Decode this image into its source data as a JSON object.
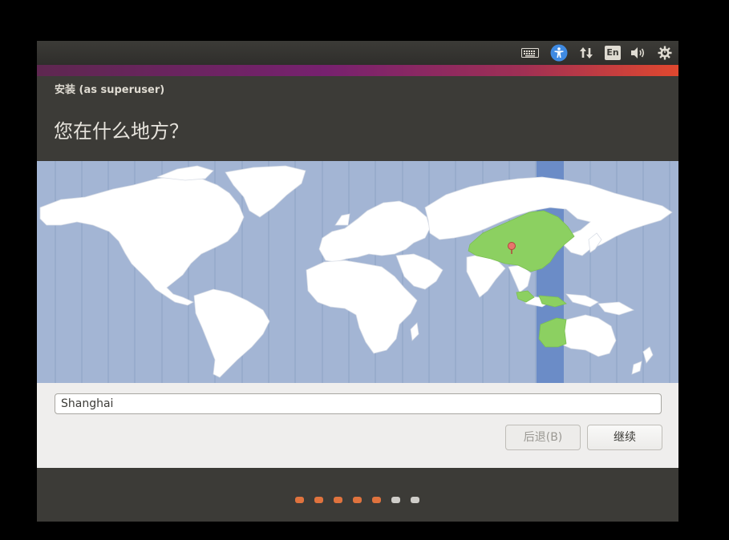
{
  "panel": {
    "indicators": [
      {
        "icon": "keyboard-icon"
      },
      {
        "icon": "accessibility-icon",
        "color": "#3f8ae2"
      },
      {
        "icon": "network-icon"
      },
      {
        "icon": "language-icon",
        "label": "En"
      },
      {
        "icon": "volume-icon"
      },
      {
        "icon": "power-gear-icon"
      }
    ]
  },
  "window": {
    "title": "安装 (as superuser)",
    "question": "您在什么地方？"
  },
  "map": {
    "selected_region_color": "#8cd061",
    "timezone_band_color": "#6b8cc7",
    "land_color": "#ffffff",
    "ocean_color": "#a3b5d4",
    "pin_icon": "location-pin-icon"
  },
  "location": {
    "value": "Shanghai"
  },
  "buttons": {
    "back_label": "后退(B)",
    "next_label": "继续"
  },
  "progress": {
    "total_steps": 7,
    "completed_steps": 5,
    "active_color": "#e0733e",
    "inactive_color": "#cfcdc9"
  }
}
